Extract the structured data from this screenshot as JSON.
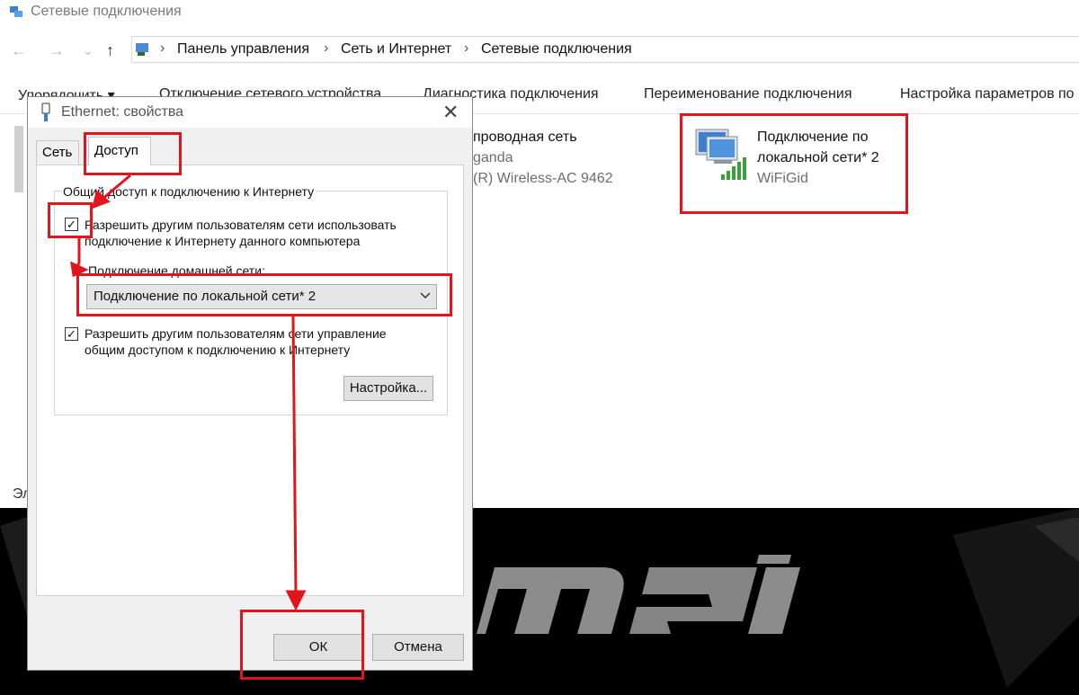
{
  "window": {
    "title": "Сетевые подключения"
  },
  "nav": {
    "back": "←",
    "forward": "→",
    "dropdown": "⌄",
    "up": "↑"
  },
  "breadcrumb": {
    "sep": "›",
    "items": [
      "Панель управления",
      "Сеть и Интернет",
      "Сетевые подключения"
    ]
  },
  "commands": [
    "Упорядочить ▾",
    "Отключение сетевого устройства",
    "Диагностика подключения",
    "Переименование подключения",
    "Настройка параметров по"
  ],
  "connections": {
    "wireless": {
      "name": "проводная сеть",
      "network": "ganda",
      "adapter": "(R) Wireless-AC 9462"
    },
    "local": {
      "name_line1": "Подключение по",
      "name_line2": "локальной сети* 2",
      "network": "WiFiGid"
    }
  },
  "status_fragment": "Эл",
  "dialog": {
    "title": "Ethernet: свойства",
    "close": "✕",
    "tabs": [
      "Сеть",
      "Доступ"
    ],
    "group_label": "Общий доступ к подключению к Интернету",
    "option1_line1": "Разрешить другим пользователям сети использовать",
    "option1_line2": "подключение к Интернету данного компьютера",
    "option1_checked": true,
    "home_label": "Подключение домашней сети:",
    "home_value": "Подключение по локальной сети* 2",
    "option2_line1": "Разрешить другим пользователям сети управление",
    "option2_line2": "общим доступом к подключению к Интернету",
    "option2_checked": true,
    "settings_button": "Настройка...",
    "ok_button": "ОК",
    "cancel_button": "Отмена",
    "check_glyph": "✓"
  },
  "colors": {
    "highlight": "#e4141c",
    "signal": "#3aa03a",
    "dark_bg": "#000000"
  }
}
